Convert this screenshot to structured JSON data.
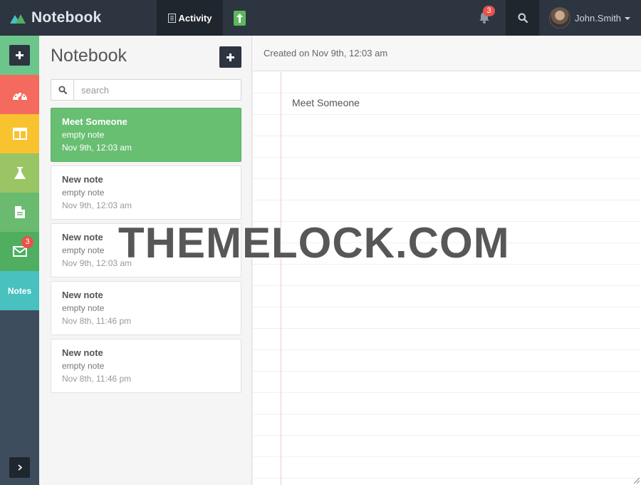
{
  "app": {
    "brand": "Notebook"
  },
  "topbar": {
    "activity_label": "Activity",
    "notifications_count": "3",
    "user_name": "John.Smith"
  },
  "sidebar": {
    "items": [
      {
        "name": "add",
        "color": "#6cc58a"
      },
      {
        "name": "dashboard",
        "color": "#f46a5e"
      },
      {
        "name": "layout",
        "color": "#f9c330"
      },
      {
        "name": "lab",
        "color": "#99c565"
      },
      {
        "name": "documents",
        "color": "#6abb6f"
      },
      {
        "name": "mail",
        "color": "#4fae60",
        "badge": "3"
      },
      {
        "name": "notes",
        "color": "#48c1bf",
        "label": "Notes"
      }
    ]
  },
  "list": {
    "title": "Notebook",
    "search_placeholder": "search",
    "notes": [
      {
        "title": "Meet Someone",
        "subtitle": "empty note",
        "date": "Nov 9th, 12:03 am"
      },
      {
        "title": "New note",
        "subtitle": "empty note",
        "date": "Nov 9th, 12:03 am"
      },
      {
        "title": "New note",
        "subtitle": "empty note",
        "date": "Nov 9th, 12:03 am"
      },
      {
        "title": "New note",
        "subtitle": "empty note",
        "date": "Nov 8th, 11:46 pm"
      },
      {
        "title": "New note",
        "subtitle": "empty note",
        "date": "Nov 8th, 11:46 pm"
      }
    ]
  },
  "editor": {
    "created_label": "Created on Nov 9th, 12:03 am",
    "content": "Meet Someone"
  },
  "watermark": "THEMELOCK.COM"
}
